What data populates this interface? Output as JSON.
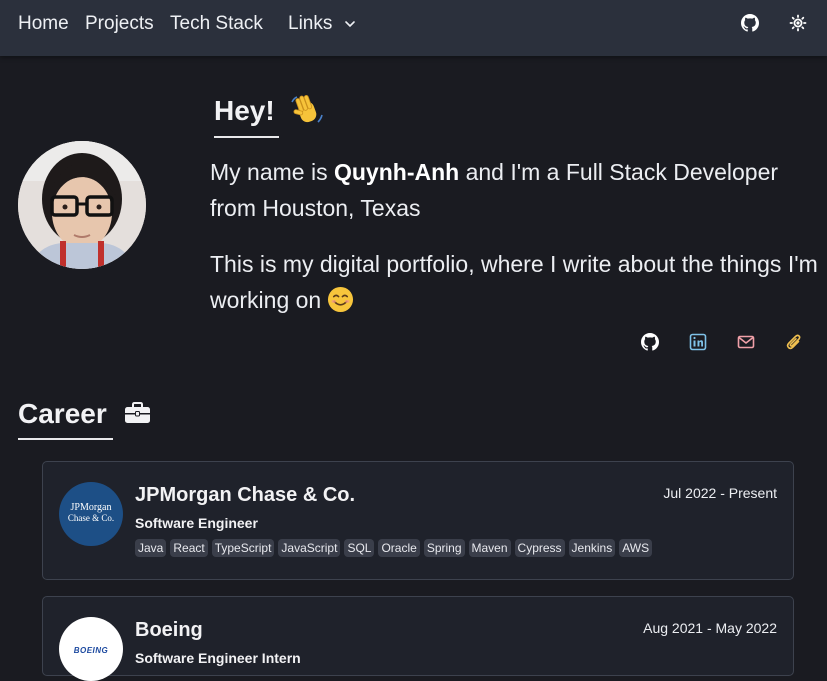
{
  "nav": {
    "links": [
      "Home",
      "Projects",
      "Tech Stack",
      "Links"
    ],
    "icons": [
      "github-icon",
      "theme-toggle-icon"
    ]
  },
  "hero": {
    "greeting": "Hey!",
    "intro_prefix": "My name is ",
    "name": "Quynh-Anh",
    "intro_suffix": " and I'm a Full Stack Developer from Houston, Texas",
    "portfolio_text": "This is my digital portfolio, where I write about the things I'm working on",
    "social_icons": [
      "github-icon",
      "linkedin-icon",
      "email-icon",
      "resume-icon"
    ]
  },
  "career": {
    "title": "Career",
    "jobs": [
      {
        "company": "JPMorgan Chase & Co.",
        "logo_text_line1": "JPMorgan",
        "logo_text_line2": "Chase & Co.",
        "role": "Software Engineer",
        "dates": "Jul 2022 - Present",
        "tags": [
          "Java",
          "React",
          "TypeScript",
          "JavaScript",
          "SQL",
          "Oracle",
          "Spring",
          "Maven",
          "Cypress",
          "Jenkins",
          "AWS"
        ]
      },
      {
        "company": "Boeing",
        "logo_text": "BOEING",
        "role": "Software Engineer Intern",
        "dates": "Aug 2021 - May 2022"
      }
    ]
  },
  "colors": {
    "background": "#1a1b21",
    "navbar": "#2b303c",
    "card": "#1f222b",
    "tag": "#3a3e4a",
    "linkedin": "#7fc2e8",
    "email": "#f0a0a8",
    "resume": "#f0c050",
    "jpm_logo": "#1d4f86"
  }
}
